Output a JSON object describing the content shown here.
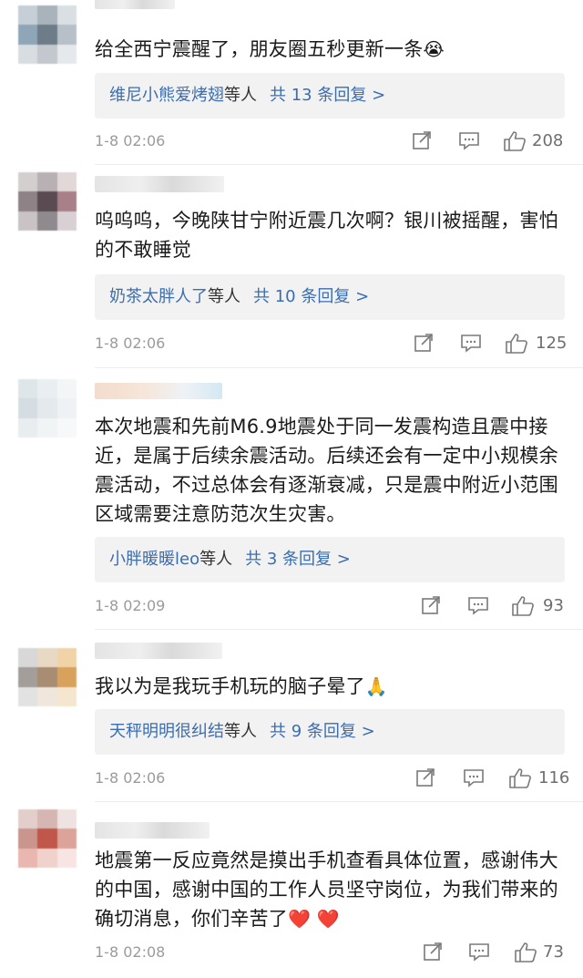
{
  "comments": [
    {
      "avatar_colors": [
        "#c7cfd6",
        "#a9b3bc",
        "#d9dfe3",
        "#8fa5b8",
        "#6d7c88",
        "#b7c0c8",
        "#d8dde1",
        "#c2c8cd",
        "#e6e9ec"
      ],
      "text": "给全西宁震醒了，朋友圈五秒更新一条",
      "emoji": "😭",
      "reply_from": "维尼小熊爱烤翅",
      "reply_mid": "等人",
      "reply_count": "共 13 条回复 >",
      "time": "1-8 02:06",
      "likes": "208"
    },
    {
      "avatar_colors": [
        "#d4cfcf",
        "#b8b1b3",
        "#e2d8d8",
        "#8e8286",
        "#5a4a52",
        "#a7808a",
        "#c9c3c6",
        "#8f8a8e",
        "#d8d0d4"
      ],
      "text": "呜呜呜，今晚陕甘宁附近震几次啊？银川被摇醒，害怕的不敢睡觉",
      "emoji": "",
      "reply_from": "奶茶太胖人了",
      "reply_mid": "等人",
      "reply_count": "共 10 条回复 >",
      "time": "1-8 02:06",
      "likes": "125"
    },
    {
      "avatar_colors": [
        "#dfe6ea",
        "#e9eef1",
        "#f3f5f6",
        "#d5dde2",
        "#e3e9ec",
        "#eef2f4",
        "#e8edf0",
        "#f1f4f5",
        "#f7f8f9"
      ],
      "text": "本次地震和先前M6.9地震处于同一发震构造且震中接近，是属于后续余震活动。后续还会有一定中小规模余震活动，不过总体会有逐渐衰减，只是震中附近小范围区域需要注意防范次生灾害。",
      "emoji": "",
      "reply_from": "小胖暖暖leo",
      "reply_mid": "等人",
      "reply_count": "共 3 条回复 >",
      "time": "1-8 02:09",
      "likes": "93"
    },
    {
      "avatar_colors": [
        "#d8d8d8",
        "#e7d9c4",
        "#f0d4a8",
        "#a39e99",
        "#a88d72",
        "#d8a25c",
        "#e2e2e2",
        "#efe7dc",
        "#f4e6cf"
      ],
      "text": "我以为是我玩手机玩的脑子晕了",
      "emoji": "🙏",
      "reply_from": "天秤明明很纠结",
      "reply_mid": "等人",
      "reply_count": "共 9 条回复 >",
      "time": "1-8 02:06",
      "likes": "116"
    },
    {
      "avatar_colors": [
        "#e2cfcc",
        "#d5b6b2",
        "#efe3e1",
        "#c9958d",
        "#c0574a",
        "#dca39b",
        "#e9b7b0",
        "#f1d1cc",
        "#f6e5e2"
      ],
      "text": "地震第一反应竟然是摸出手机查看具体位置，感谢伟大的中国，感谢中国的工作人员坚守岗位，为我们带来的确切消息，你们辛苦了",
      "emoji": "❤️ ❤️",
      "reply_from": "",
      "reply_mid": "",
      "reply_count": "",
      "time": "1-8 02:08",
      "likes": "73"
    }
  ]
}
